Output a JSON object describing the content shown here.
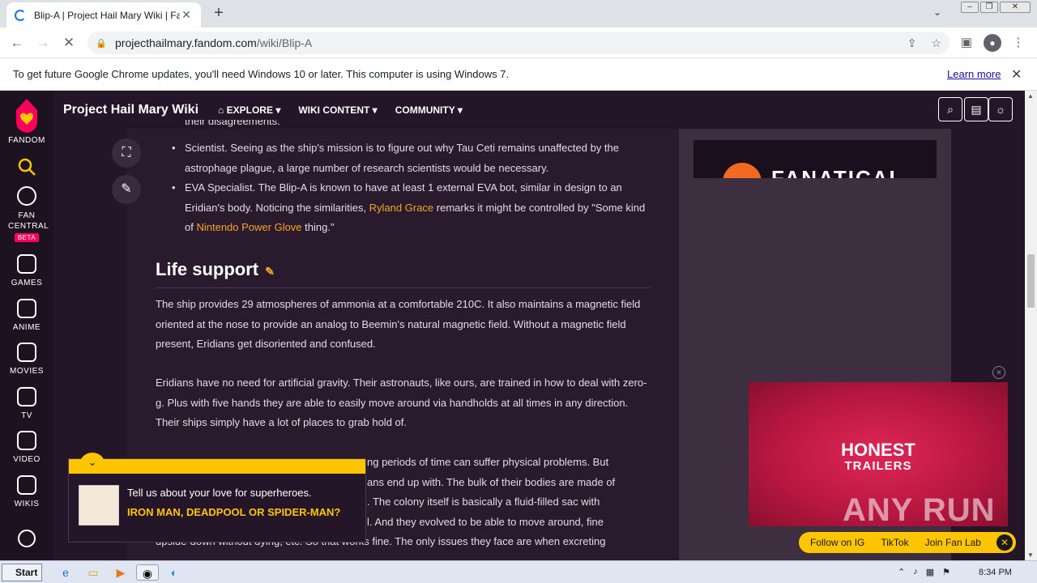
{
  "browser": {
    "tab_title": "Blip-A | Project Hail Mary Wiki | Fandom",
    "new_tab_glyph": "+",
    "url_host": "projecthailmary.fandom.com",
    "url_path": "/wiki/Blip-A"
  },
  "infobar": {
    "message": "To get future Google Chrome updates, you'll need Windows 10 or later. This computer is using Windows 7.",
    "learn_more": "Learn more"
  },
  "rail": {
    "fandom": "FANDOM",
    "fan_central": "FAN CENTRAL",
    "beta": "BETA",
    "games": "GAMES",
    "anime": "ANIME",
    "movies": "MOVIES",
    "tv": "TV",
    "video": "VIDEO",
    "wikis": "WIKIS"
  },
  "wiki": {
    "title": "Project Hail Mary Wiki",
    "menu_explore": "EXPLORE",
    "menu_wiki_content": "WIKI CONTENT",
    "menu_community": "COMMUNITY"
  },
  "article": {
    "bullet0_tail": "their disagreements.",
    "bullet1": "Scientist. Seeing as the ship's mission is to figure out why Tau Ceti remains unaffected by the astrophage plague, a large number of research scientists would be necessary.",
    "bullet2_a": "EVA Specialist. The Blip-A is known to have at least 1 external EVA bot, similar in design to an Eridian's body. Noticing the similarities, ",
    "bullet2_link1": "Ryland Grace",
    "bullet2_b": " remarks it might be controlled by \"Some kind of ",
    "bullet2_link2": "Nintendo Power Glove",
    "bullet2_c": " thing.\"",
    "heading": "Life support",
    "para1": "The ship provides 29 atmospheres of ammonia at a comfortable 210C. It also maintains a magnetic field oriented at the nose to provide an analog to Beemin's natural magnetic field. Without a magnetic field present, Eridians get disoriented and confused.",
    "para2": "Eridians have no need for artificial gravity. Their astronauts, like ours, are trained in how to deal with zero-g. Plus with five hands they are able to easily move around via handholds at all times in any direction. Their ships simply have a lot of places to grab hold of.",
    "para3_l1": "ng periods of time can suffer physical problems. But",
    "para3_l2": "ans end up with. The bulk of their bodies are made of",
    "para3_l3": ". The colony itself is basically a fluid-filled sac with",
    "para3_l4": "l. And they evolved to be able to move around, fine",
    "para3_l5": "upside-down without dying, etc. So that works fine. The only issues they face are when excreting"
  },
  "ads": {
    "fanatical": "FANATICAL",
    "honest": "HONEST",
    "trailers": "TRAILERS",
    "follow_ig": "Follow on IG",
    "tiktok": "TikTok",
    "join_fan_lab": "Join Fan Lab"
  },
  "quiz": {
    "prompt": "Tell us about your love for superheroes.",
    "question": "IRON MAN, DEADPOOL OR SPIDER-MAN?"
  },
  "watermark": "ANY RUN",
  "taskbar": {
    "start": "Start",
    "time": "8:34 PM"
  }
}
